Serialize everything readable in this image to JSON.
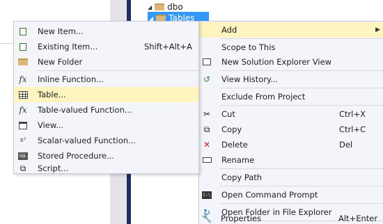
{
  "tree": {
    "dbo_label": "dbo",
    "tables_label": "Tables"
  },
  "context_menu": {
    "items": [
      {
        "label": "Add",
        "shortcut": "",
        "icon": ""
      },
      {
        "label": "Scope to This",
        "shortcut": "",
        "icon": ""
      },
      {
        "label": "New Solution Explorer View",
        "shortcut": "",
        "icon": "new-view-icon"
      },
      {
        "label": "View History...",
        "shortcut": "",
        "icon": "history-icon"
      },
      {
        "label": "Exclude From Project",
        "shortcut": "",
        "icon": ""
      },
      {
        "label": "Cut",
        "shortcut": "Ctrl+X",
        "icon": "scissors-icon"
      },
      {
        "label": "Copy",
        "shortcut": "Ctrl+C",
        "icon": "copy-icon"
      },
      {
        "label": "Delete",
        "shortcut": "Del",
        "icon": "delete-x-icon"
      },
      {
        "label": "Rename",
        "shortcut": "",
        "icon": "rename-icon"
      },
      {
        "label": "Copy Path",
        "shortcut": "",
        "icon": ""
      },
      {
        "label": "Open Command Prompt",
        "shortcut": "",
        "icon": "command-prompt-icon"
      },
      {
        "label": "Open Folder in File Explorer",
        "shortcut": "",
        "icon": "refresh-arrow-icon"
      },
      {
        "label": "Properties",
        "shortcut": "Alt+Enter",
        "icon": "wrench-icon"
      }
    ]
  },
  "submenu": {
    "items": [
      {
        "label": "New Item...",
        "shortcut": "",
        "icon": "new-item-icon"
      },
      {
        "label": "Existing Item...",
        "shortcut": "Shift+Alt+A",
        "icon": "existing-item-icon"
      },
      {
        "label": "New Folder",
        "shortcut": "",
        "icon": "folder-icon"
      },
      {
        "label": "Inline Function...",
        "shortcut": "",
        "icon": "function-icon"
      },
      {
        "label": "Table...",
        "shortcut": "",
        "icon": "table-icon"
      },
      {
        "label": "Table-valued Function...",
        "shortcut": "",
        "icon": "function-icon"
      },
      {
        "label": "View...",
        "shortcut": "",
        "icon": "view-icon"
      },
      {
        "label": "Scalar-valued Function...",
        "shortcut": "",
        "icon": "scalar-function-icon"
      },
      {
        "label": "Stored Procedure...",
        "shortcut": "",
        "icon": "stored-procedure-icon"
      },
      {
        "label": "Script...",
        "shortcut": "",
        "icon": "script-icon"
      }
    ]
  },
  "colors": {
    "highlight": "#fdf4bf",
    "selection": "#3399ff",
    "menu_bg": "#f4f5fb"
  }
}
